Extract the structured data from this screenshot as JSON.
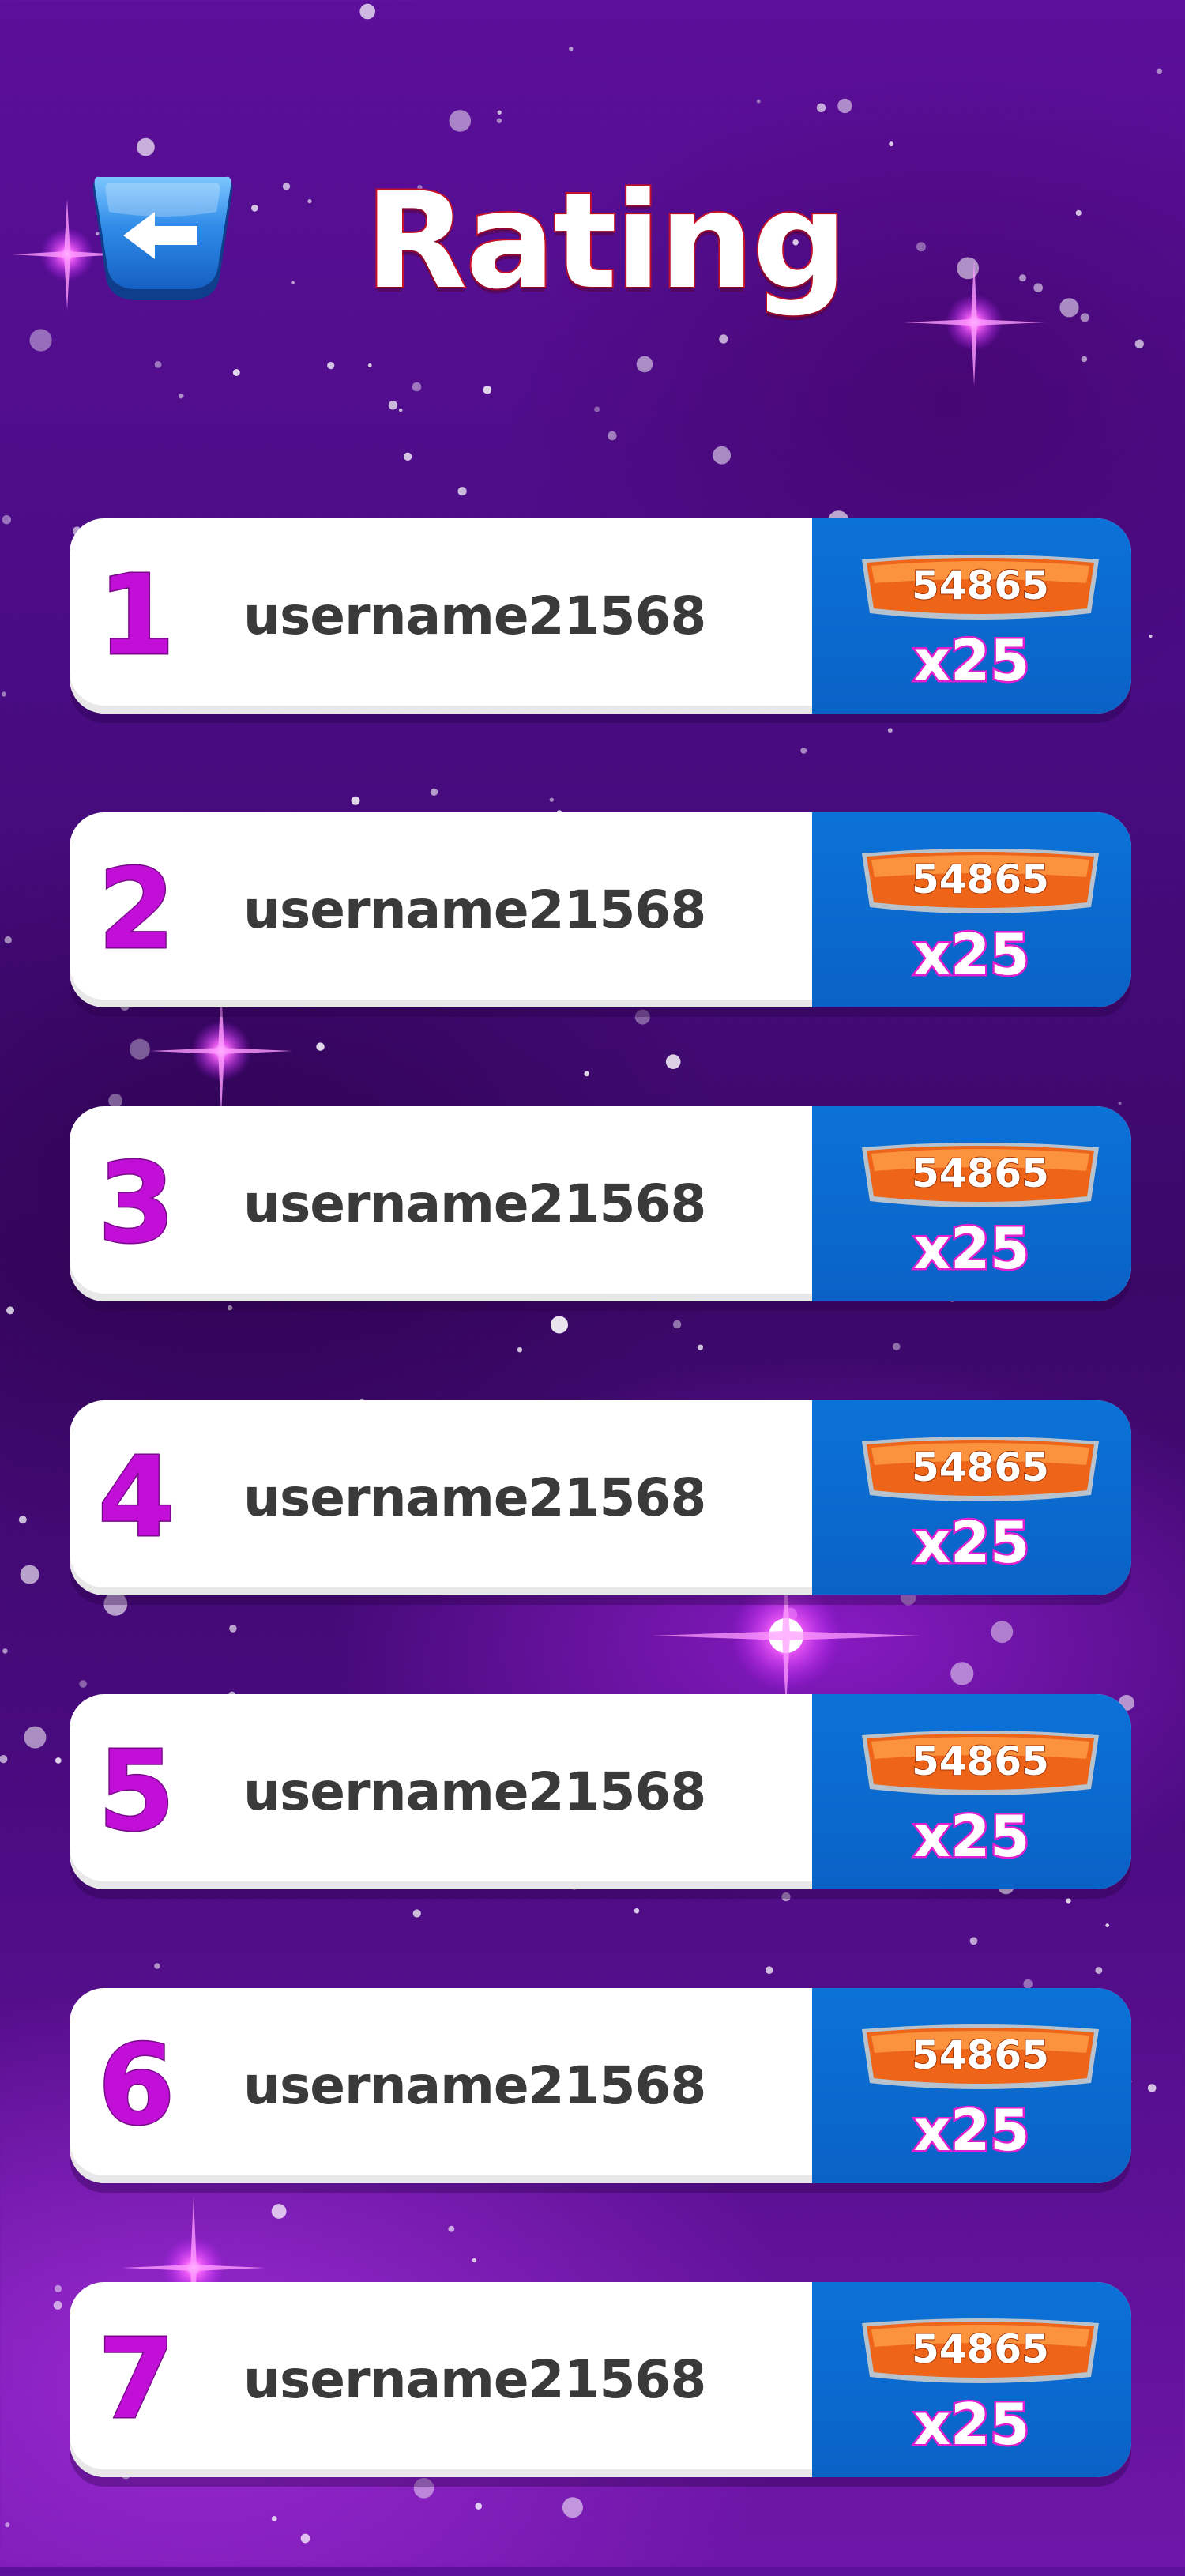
{
  "header": {
    "title": "Rating",
    "back_icon": "arrow-left-icon"
  },
  "colors": {
    "background": "#4a0c84",
    "rank": "#c20fd8",
    "score_panel": "#0a68cc",
    "score_badge": "#f06a1c",
    "multiplier_outline": "#e21ccf",
    "title_outline": "#c4102a"
  },
  "rating": {
    "rows": [
      {
        "rank": "1",
        "username": "username21568",
        "score": "54865",
        "multiplier": "x25"
      },
      {
        "rank": "2",
        "username": "username21568",
        "score": "54865",
        "multiplier": "x25"
      },
      {
        "rank": "3",
        "username": "username21568",
        "score": "54865",
        "multiplier": "x25"
      },
      {
        "rank": "4",
        "username": "username21568",
        "score": "54865",
        "multiplier": "x25"
      },
      {
        "rank": "5",
        "username": "username21568",
        "score": "54865",
        "multiplier": "x25"
      },
      {
        "rank": "6",
        "username": "username21568",
        "score": "54865",
        "multiplier": "x25"
      },
      {
        "rank": "7",
        "username": "username21568",
        "score": "54865",
        "multiplier": "x25"
      }
    ]
  }
}
